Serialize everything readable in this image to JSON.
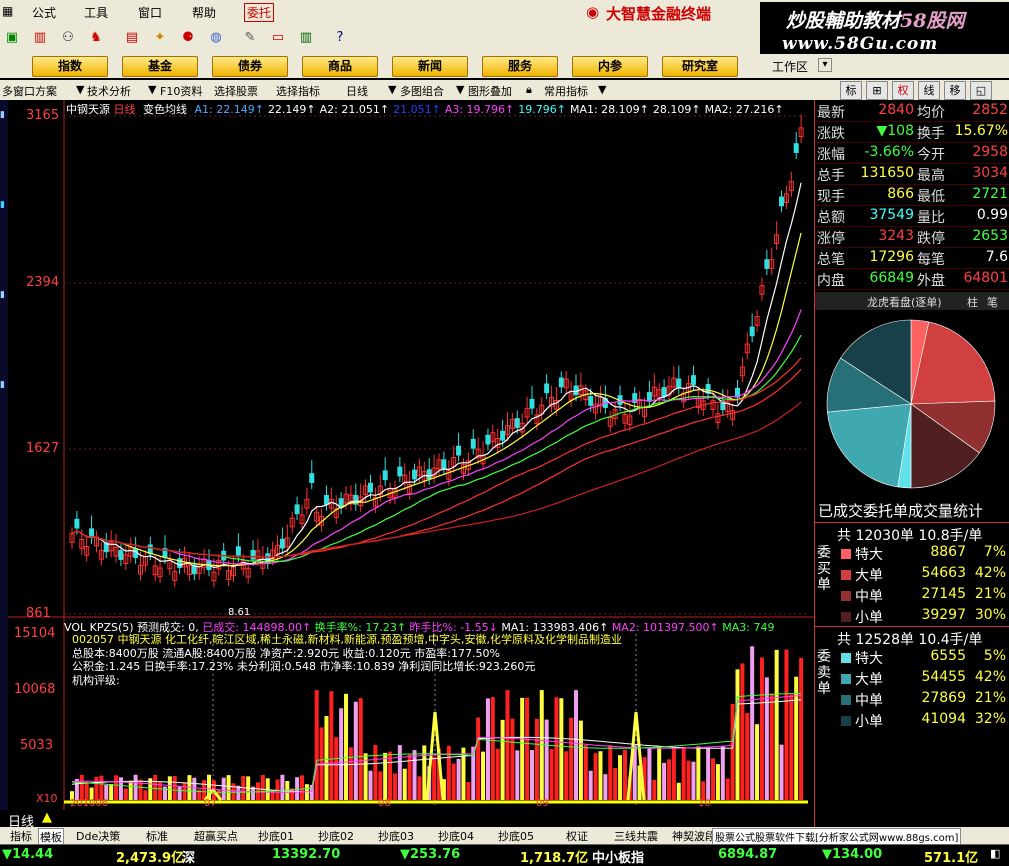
{
  "menu": {
    "items": [
      "公式",
      "工具",
      "窗口",
      "帮助"
    ],
    "entrust": "委托",
    "brand": "大智慧金融终端"
  },
  "watermark": {
    "line1_a": "炒股輔助教材",
    "line1_b": "58股网",
    "line2": "www.58Gu.com"
  },
  "sections": [
    "指数",
    "基金",
    "债券",
    "商品",
    "新闻",
    "服务",
    "内参",
    "研究室"
  ],
  "work_zone": "工作区",
  "controls": [
    "多窗口方案",
    "技术分析",
    "F10资料",
    "选择股票",
    "选择指标",
    "日线",
    "多图组合",
    "图形叠加",
    "常用指标"
  ],
  "right_buttons": [
    "标",
    "权",
    "线",
    "移"
  ],
  "chart_header": {
    "name": "中钢天源",
    "period": "日线",
    "indicator": "变色均线",
    "ma_text": [
      {
        "t": "A1: 22.149↑",
        "c": "#4da6ff"
      },
      {
        "t": "22.149↑",
        "c": "#ffffff"
      },
      {
        "t": "A2: 21.051↑",
        "c": "#ffffff"
      },
      {
        "t": "21.051↑",
        "c": "#2040ff"
      },
      {
        "t": "A3: 19.796↑",
        "c": "#ff40ff"
      },
      {
        "t": "19.796↑",
        "c": "#40ffff"
      },
      {
        "t": "MA1: 28.109↑",
        "c": "#ffffff"
      },
      {
        "t": "28.109↑",
        "c": "#ffffff"
      },
      {
        "t": "MA2: 27.216↑",
        "c": "#ffffff"
      }
    ]
  },
  "price_axis": [
    "3165",
    "2394",
    "1627",
    "861"
  ],
  "low_label": "8.61",
  "volume_header": {
    "name": "VOL KPZS(5)",
    "pred": "预测成交: 0,",
    "done": "已成交: 144898.00↑",
    "turn": "换手率%: 17.23↑",
    "prev": "昨手比%: -1.55↓",
    "ma1": "MA1: 133983.406↑",
    "ma2": "MA2: 101397.500↑",
    "ma3": "MA3: 749"
  },
  "volume_axis": [
    "15104",
    "10068",
    "5033",
    "X10"
  ],
  "info": {
    "line1": "002057 中钢天源 化工化纤,皖江区域,稀土永磁,新材料,新能源,预盈预增,中字头,安徽,化学原料及化学制品制造业",
    "line2": "总股本:8400万股  流通A股:8400万股  净资产:2.920元  收益:0.120元  市盈率:177.50%",
    "line3": "公积金:1.245  日换手率:17.23%  未分利润:0.548  市净率:10.839  净利润同比增长:923.260元",
    "line4": "机构评级:"
  },
  "date_axis": [
    "201006",
    "07",
    "08",
    "09",
    "10"
  ],
  "quote": [
    {
      "l1": "最新",
      "v1": "2840",
      "c1": "#ff4040",
      "l2": "均价",
      "v2": "2852",
      "c2": "#ff4040"
    },
    {
      "l1": "涨跌",
      "v1": "▼108",
      "c1": "#40ff40",
      "l2": "换手",
      "v2": "15.67%",
      "c2": "#ffff40"
    },
    {
      "l1": "涨幅",
      "v1": "-3.66%",
      "c1": "#40ff40",
      "l2": "今开",
      "v2": "2958",
      "c2": "#ff4040"
    },
    {
      "l1": "总手",
      "v1": "131650",
      "c1": "#ffff40",
      "l2": "最高",
      "v2": "3034",
      "c2": "#ff4040"
    },
    {
      "l1": "现手",
      "v1": "866",
      "c1": "#ffff40",
      "l2": "最低",
      "v2": "2721",
      "c2": "#40ff40"
    },
    {
      "l1": "总额",
      "v1": "37549",
      "c1": "#40ffff",
      "l2": "量比",
      "v2": "0.99",
      "c2": "#ffffff"
    },
    {
      "l1": "涨停",
      "v1": "3243",
      "c1": "#ff4040",
      "l2": "跌停",
      "v2": "2653",
      "c2": "#40ff40"
    },
    {
      "l1": "总笔",
      "v1": "17296",
      "c1": "#ffff40",
      "l2": "每笔",
      "v2": "7.6",
      "c2": "#ffffff"
    },
    {
      "l1": "内盘",
      "v1": "66849",
      "c1": "#40ff40",
      "l2": "外盘",
      "v2": "64801",
      "c2": "#ff4040"
    }
  ],
  "dragon_title": "龙虎看盘(逐单)",
  "dragon_tabs": [
    "柱",
    "笔"
  ],
  "pie_title": "已成交委托单成交量统计",
  "buy": {
    "label": "委买单",
    "total": "共  12030单  10.8手/单",
    "rows": [
      {
        "n": "特大",
        "v": "8867",
        "p": "7%"
      },
      {
        "n": "大单",
        "v": "54663",
        "p": "42%"
      },
      {
        "n": "中单",
        "v": "27145",
        "p": "21%"
      },
      {
        "n": "小单",
        "v": "39297",
        "p": "30%"
      }
    ]
  },
  "sell": {
    "label": "委卖单",
    "total": "共  12528单  10.4手/单",
    "rows": [
      {
        "n": "特大",
        "v": "6555",
        "p": "5%"
      },
      {
        "n": "大单",
        "v": "54455",
        "p": "42%"
      },
      {
        "n": "中单",
        "v": "27869",
        "p": "21%"
      },
      {
        "n": "小单",
        "v": "41094",
        "p": "32%"
      }
    ]
  },
  "colors": {
    "buy": [
      "#ff6060",
      "#d04040",
      "#903030",
      "#502020"
    ],
    "sell": [
      "#60e0e8",
      "#40a8b0",
      "#287078",
      "#184048"
    ]
  },
  "bottom_period": "日线",
  "bottom_tabs": [
    "指标",
    "模板",
    "Dde决策",
    "标准",
    "超赢买点",
    "抄底01",
    "抄底02",
    "抄底03",
    "抄底04",
    "抄底05",
    "权证",
    "三线共震",
    "神契波段",
    "股票公式股票软件下载[分析家公式网www.88gs.com]"
  ],
  "status": {
    "s1": "▼14.44",
    "s2": "2,473.9亿",
    "s3": "深",
    "s4": "13392.70",
    "s5": "▼253.76",
    "s6": "1,718.7亿",
    "s7": "中小板指",
    "s8": "6894.87",
    "s9": "▼134.00",
    "s10": "571.1亿"
  }
}
